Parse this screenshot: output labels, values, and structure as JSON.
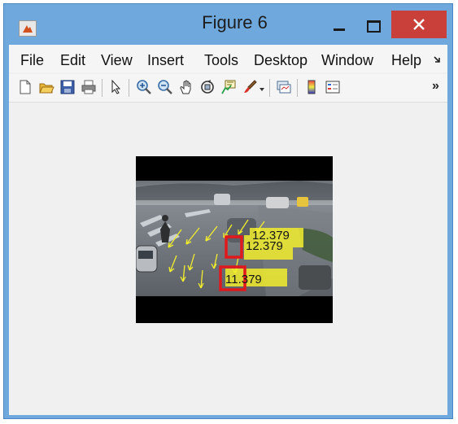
{
  "window": {
    "title": "Figure 6"
  },
  "menu": {
    "items": [
      "File",
      "Edit",
      "View",
      "Insert",
      "Tools",
      "Desktop",
      "Window",
      "Help"
    ]
  },
  "toolbar": {
    "icons": [
      "new-figure-icon",
      "open-file-icon",
      "save-icon",
      "print-icon",
      "pointer-icon",
      "zoom-in-icon",
      "zoom-out-icon",
      "pan-icon",
      "rotate-3d-icon",
      "data-cursor-icon",
      "brush-icon",
      "link-plot-icon",
      "colorbar-icon",
      "legend-icon"
    ],
    "overflow": "»"
  },
  "image": {
    "labels": [
      "12.379",
      "12.379",
      "11.379"
    ]
  },
  "colors": {
    "titlebar": "#6fa8dc",
    "close": "#c9403a",
    "flow": "#f2ee2e",
    "box": "#e0191c"
  }
}
